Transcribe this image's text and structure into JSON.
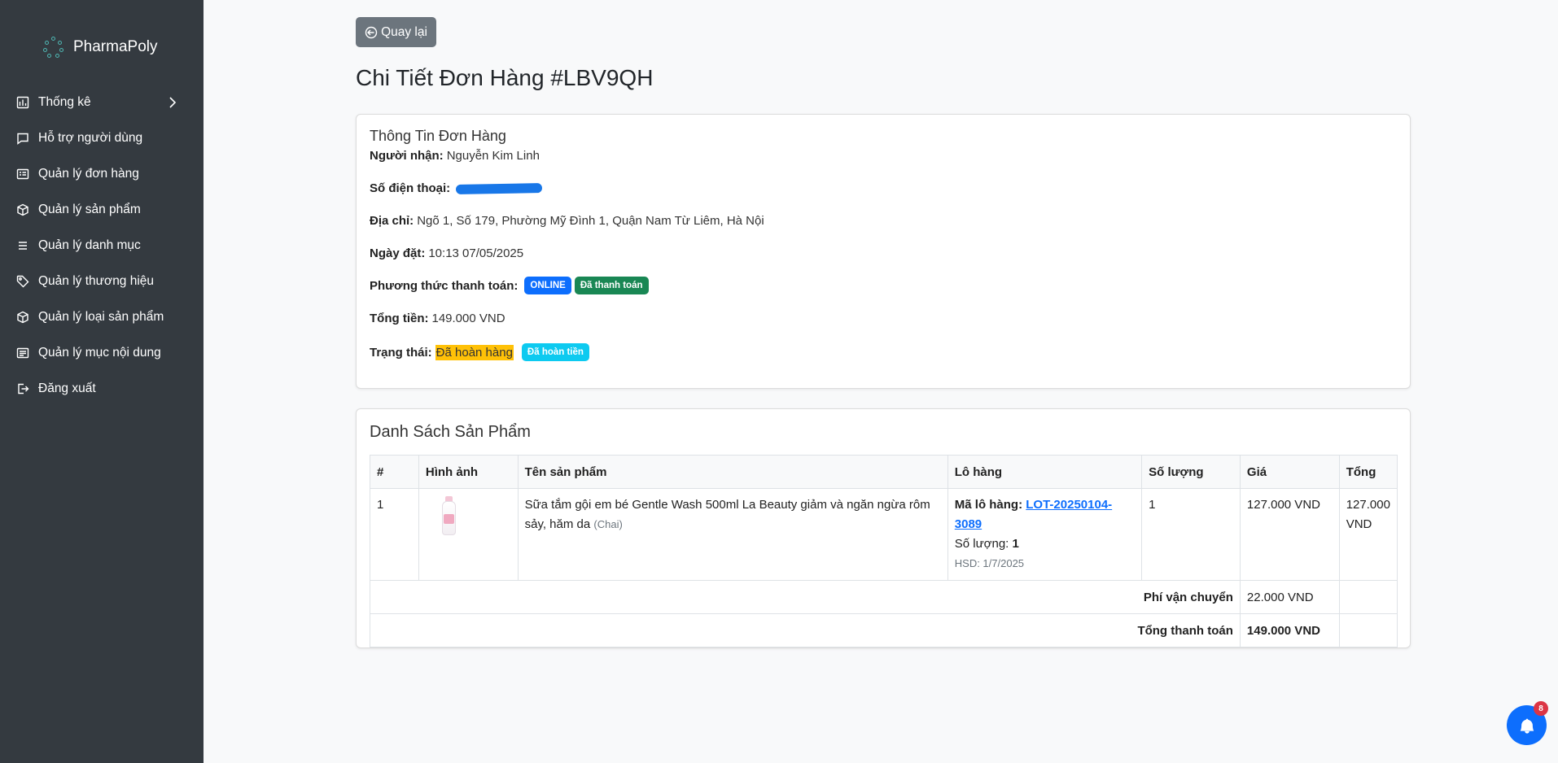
{
  "brand": {
    "name": "PharmaPoly"
  },
  "sidebar": {
    "items": [
      {
        "label": "Thống kê",
        "icon": "chart-icon"
      },
      {
        "label": "Hỗ trợ người dùng",
        "icon": "chat-icon"
      },
      {
        "label": "Quản lý đơn hàng",
        "icon": "receipt-icon"
      },
      {
        "label": "Quản lý sản phẩm",
        "icon": "box-icon"
      },
      {
        "label": "Quản lý danh mục",
        "icon": "list-icon"
      },
      {
        "label": "Quản lý thương hiệu",
        "icon": "tag-icon"
      },
      {
        "label": "Quản lý loại sản phẩm",
        "icon": "box-icon"
      },
      {
        "label": "Quản lý mục nội dung",
        "icon": "card-text-icon"
      },
      {
        "label": "Đăng xuất",
        "icon": "logout-icon"
      }
    ]
  },
  "back_button": {
    "label": "Quay lại"
  },
  "page": {
    "title": "Chi Tiết Đơn Hàng #LBV9QH"
  },
  "order_info": {
    "title": "Thông Tin Đơn Hàng",
    "recipient_label": "Người nhận:",
    "recipient": "Nguyễn Kim Linh",
    "phone_label": "Số điện thoại:",
    "address_label": "Địa chỉ:",
    "address": "Ngõ 1, Số 179, Phường Mỹ Đình 1, Quận Nam Từ Liêm, Hà Nội",
    "date_label": "Ngày đặt:",
    "date": "10:13 07/05/2025",
    "payment_label": "Phương thức thanh toán:",
    "payment_method": "ONLINE",
    "payment_status": "Đã thanh toán",
    "total_label": "Tổng tiền:",
    "total": "149.000 VND",
    "status_label": "Trạng thái:",
    "status": "Đã hoàn hàng",
    "refund_status": "Đã hoàn tiền"
  },
  "products": {
    "title": "Danh Sách Sản Phẩm",
    "headers": [
      "#",
      "Hình ảnh",
      "Tên sản phẩm",
      "Lô hàng",
      "Số lượng",
      "Giá",
      "Tổng"
    ],
    "rows": [
      {
        "index": "1",
        "name": "Sữa tắm gội em bé Gentle Wash 500ml La Beauty giảm và ngăn ngừa rôm sảy, hăm da",
        "unit": "(Chai)",
        "lot_label": "Mã lô hàng:",
        "lot_code": "LOT-20250104-3089",
        "lot_qty_label": "Số lượng:",
        "lot_qty": "1",
        "expiry": "HSD: 1/7/2025",
        "quantity": "1",
        "price": "127.000 VND",
        "total": "127.000 VND"
      }
    ],
    "shipping_label": "Phí vận chuyển",
    "shipping": "22.000 VND",
    "grand_total_label": "Tổng thanh toán",
    "grand_total": "149.000 VND"
  },
  "notifications": {
    "count": "8"
  },
  "colors": {
    "sidebar": "#343a40",
    "primary": "#0d6efd",
    "success": "#198754",
    "info": "#0dcaf0",
    "warning": "#ffc107",
    "danger": "#dc3545",
    "secondary": "#6c757d"
  }
}
